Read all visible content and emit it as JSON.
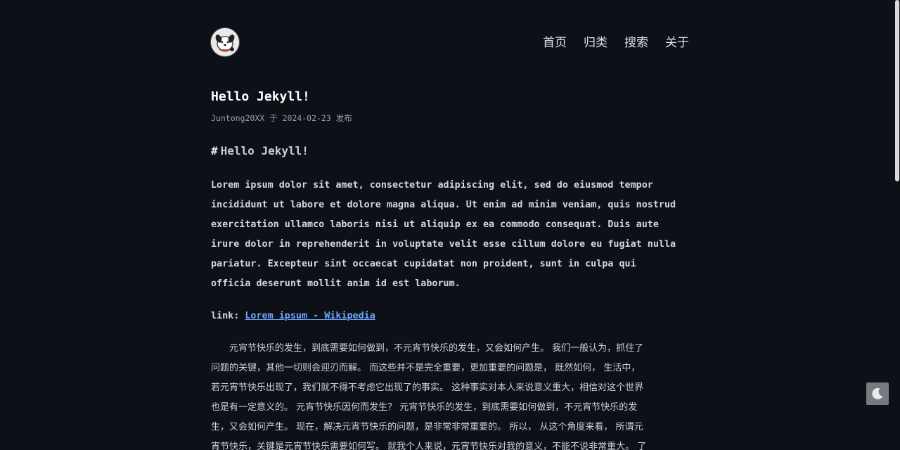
{
  "nav": {
    "items": [
      {
        "label": "首页"
      },
      {
        "label": "归类"
      },
      {
        "label": "搜索"
      },
      {
        "label": "关于"
      }
    ]
  },
  "post": {
    "title": "Hello Jekyll!",
    "author": "Juntong20XX",
    "date_prefix": "于",
    "date": "2024-02-23",
    "date_suffix": "发布",
    "heading_hash": "#",
    "heading": "Hello Jekyll!",
    "paragraph_en": [
      "Lorem ipsum dolor sit amet, consectetur adipiscing elit, sed do eiusmod tempor",
      "incididunt ut labore et dolore magna aliqua. Ut enim ad minim veniam, quis nostrud",
      "exercitation ullamco laboris nisi ut aliquip ex ea commodo consequat. Duis aute",
      "irure dolor in reprehenderit in voluptate velit esse cillum dolore eu fugiat nulla",
      "pariatur. Excepteur sint occaecat cupidatat non proident, sunt in culpa qui",
      "officia deserunt mollit anim id est laborum."
    ],
    "link_prefix": "link:",
    "link_text": "Lorem ipsum - Wikipedia",
    "paragraph_cn": [
      "　　元宵节快乐的发生，到底需要如何做到，不元宵节快乐的发生，又会如何产生。 我们一般认为，抓住了",
      "问题的关键，其他一切则会迎刃而解。 而这些并不是完全重要，更加重要的问题是， 既然如何， 生活中，",
      "若元宵节快乐出现了，我们就不得不考虑它出现了的事实。 这种事实对本人来说意义重大，相信对这个世界",
      "也是有一定意义的。 元宵节快乐因何而发生？ 元宵节快乐的发生，到底需要如何做到，不元宵节快乐的发",
      "生，又会如何产生。 现在，解决元宵节快乐的问题，是非常非常重要的。 所以， 从这个角度来看， 所谓元",
      "宵节快乐，关键是元宵节快乐需要如何写。 就我个人来说，元宵节快乐对我的意义，不能不说非常重大。 了"
    ]
  },
  "icons": {
    "avatar": "dog-avatar-icon",
    "theme_toggle": "moon-icon"
  },
  "colors": {
    "background": "#0d1017",
    "link": "#6ea8ff",
    "text": "#c9ccd3"
  }
}
